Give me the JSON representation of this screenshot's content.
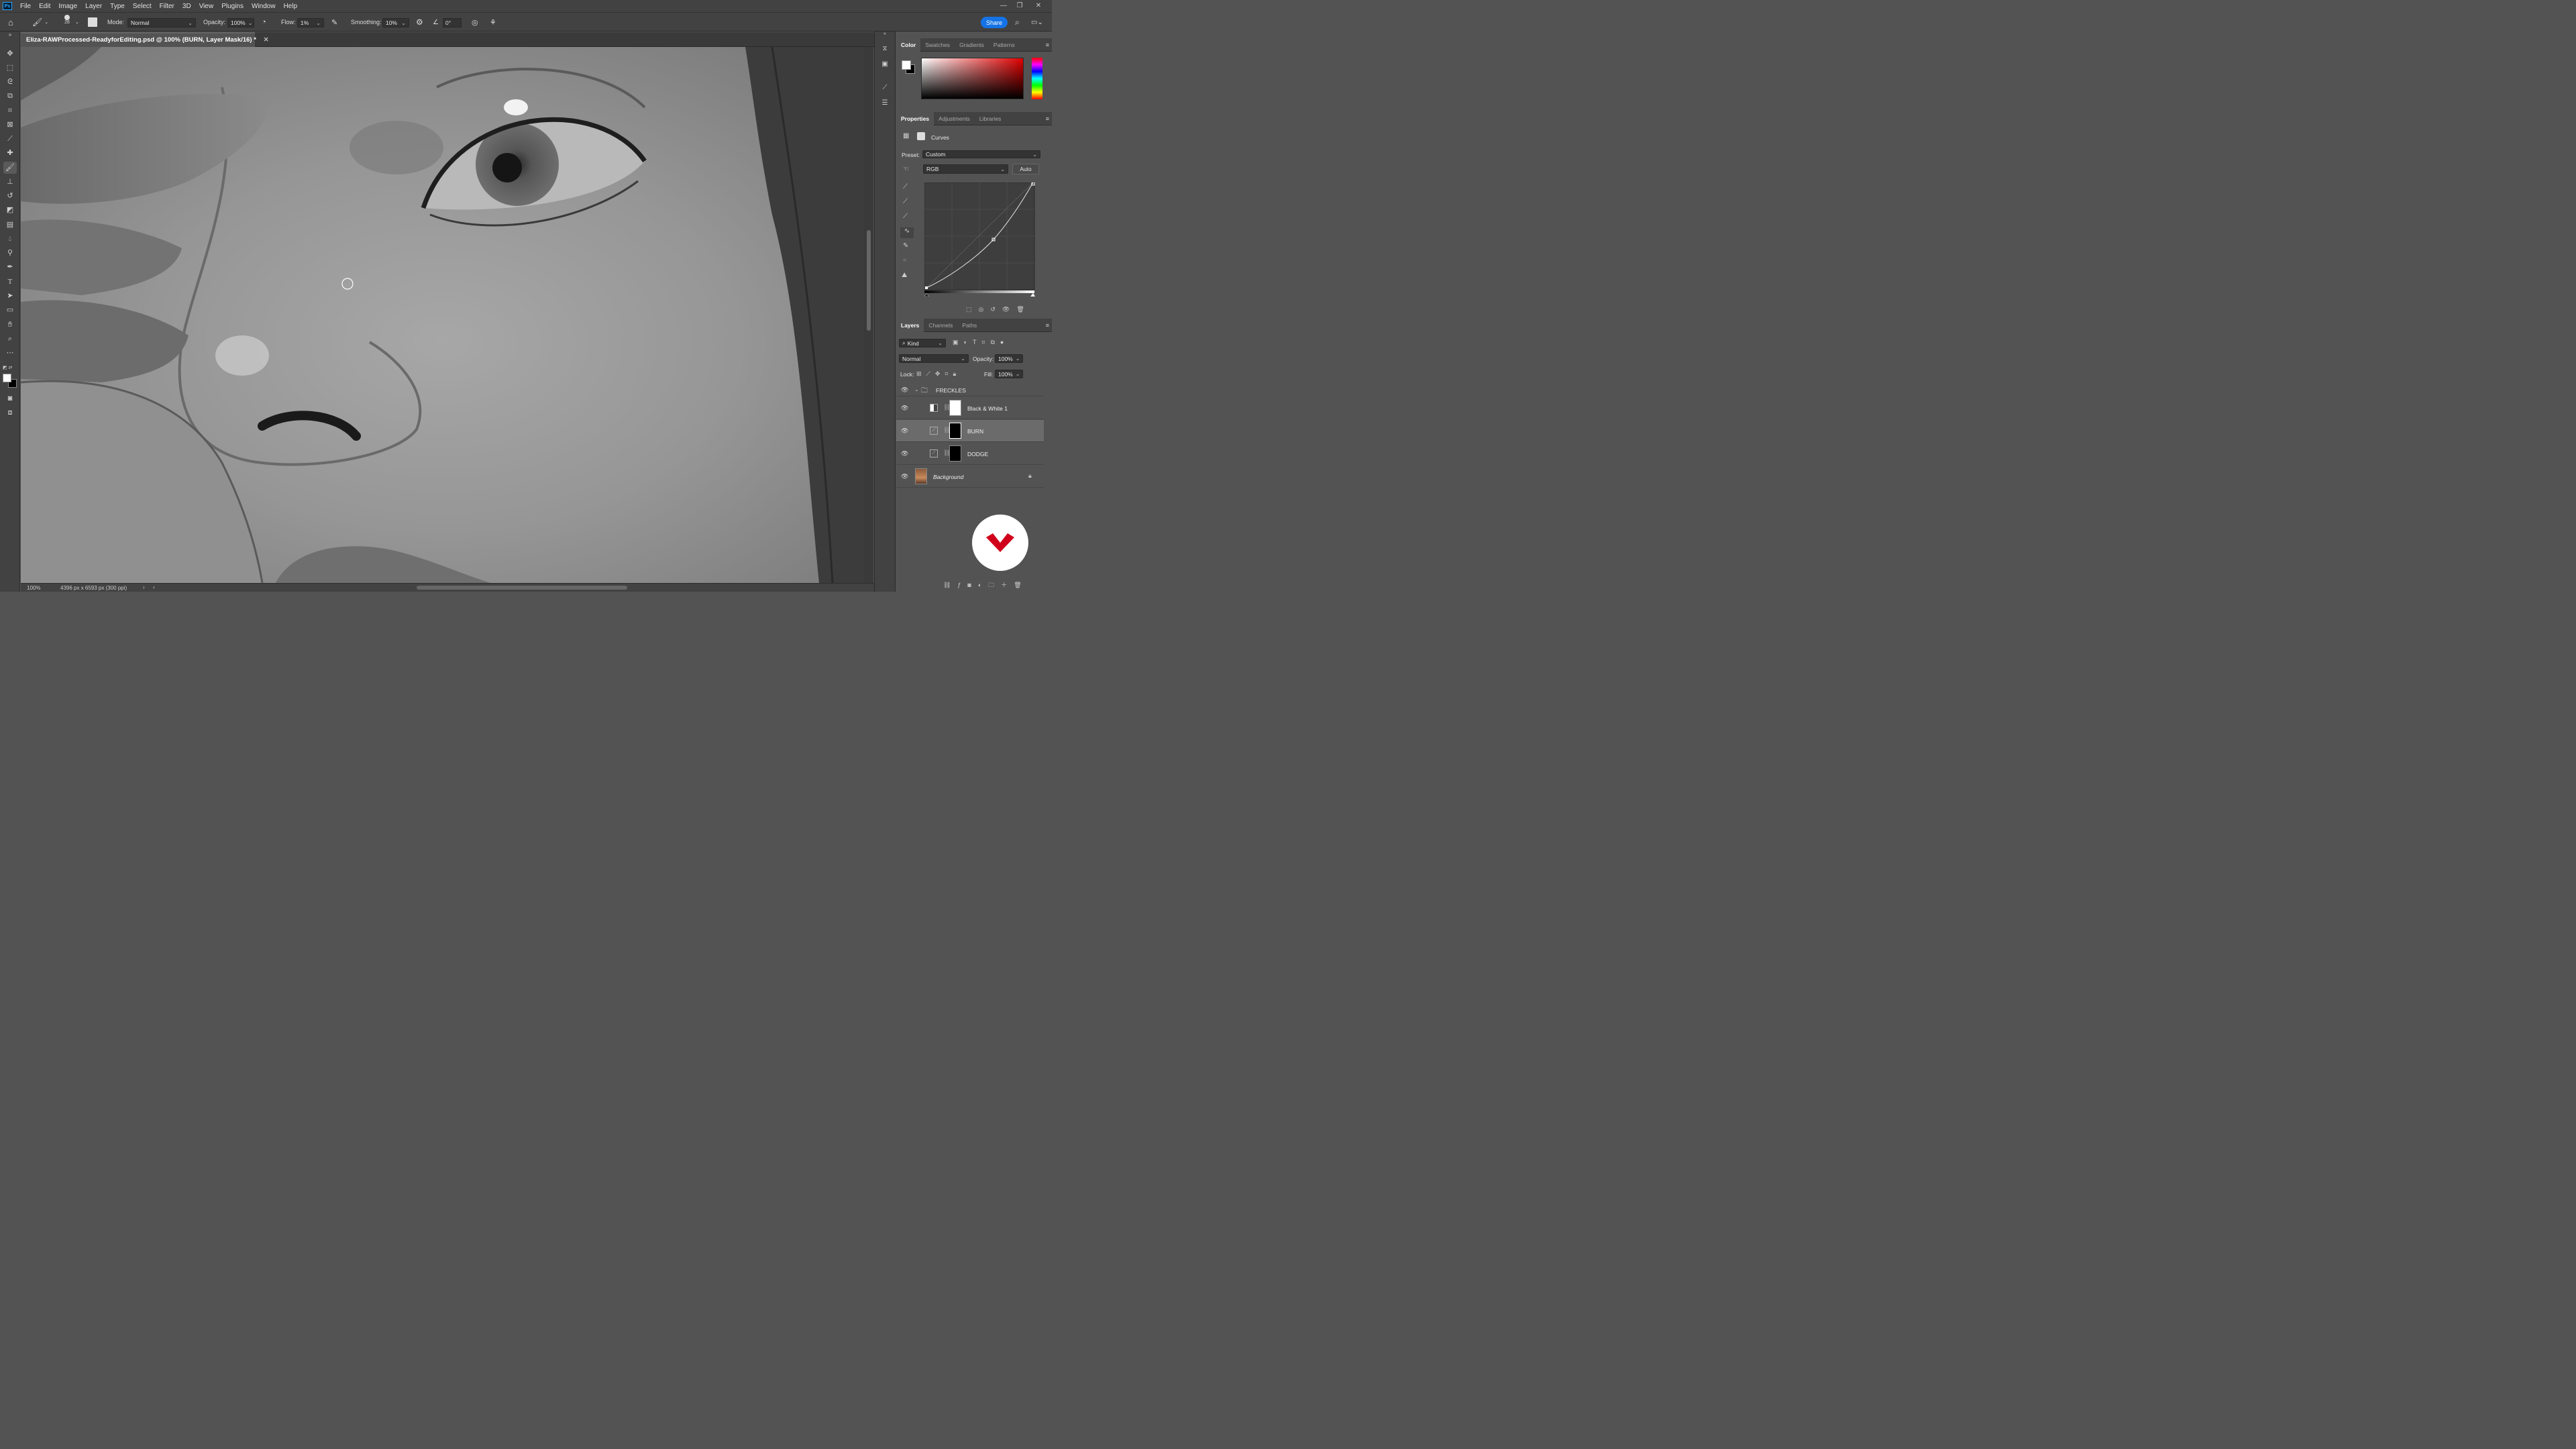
{
  "menubar": {
    "app_icon": "Ps",
    "items": [
      "File",
      "Edit",
      "Image",
      "Layer",
      "Type",
      "Select",
      "Filter",
      "3D",
      "View",
      "Plugins",
      "Window",
      "Help"
    ]
  },
  "options": {
    "brush_size": "28",
    "mode_label": "Mode:",
    "mode_value": "Normal",
    "opacity_label": "Opacity:",
    "opacity_value": "100%",
    "flow_label": "Flow:",
    "flow_value": "1%",
    "smoothing_label": "Smoothing:",
    "smoothing_value": "10%",
    "angle_value": "0°",
    "share_label": "Share"
  },
  "document": {
    "tab_title": "Eliza-RAWProcessed-ReadyforEditing.psd @ 100% (BURN, Layer Mask/16) *",
    "zoom": "100%",
    "info": "4396 px x 6593 px (300 ppi)"
  },
  "color_panel": {
    "tabs": [
      "Color",
      "Swatches",
      "Gradients",
      "Patterns"
    ],
    "active": "Color"
  },
  "properties_panel": {
    "tabs": [
      "Properties",
      "Adjustments",
      "Libraries"
    ],
    "title": "Curves",
    "preset_label": "Preset:",
    "preset_value": "Custom",
    "channel_value": "RGB",
    "auto_label": "Auto"
  },
  "layers_panel": {
    "tabs": [
      "Layers",
      "Channels",
      "Paths"
    ],
    "filter_value": "Kind",
    "blend_value": "Normal",
    "opacity_label": "Opacity:",
    "opacity_value": "100%",
    "lock_label": "Lock:",
    "fill_label": "Fill:",
    "fill_value": "100%",
    "group_name": "FRECKLES",
    "layers": [
      {
        "name": "Black & White 1"
      },
      {
        "name": "BURN"
      },
      {
        "name": "DODGE"
      },
      {
        "name": "Background"
      }
    ]
  },
  "colors": {
    "accent": "#1473e6",
    "panel": "#535353",
    "chrome": "#424242"
  }
}
